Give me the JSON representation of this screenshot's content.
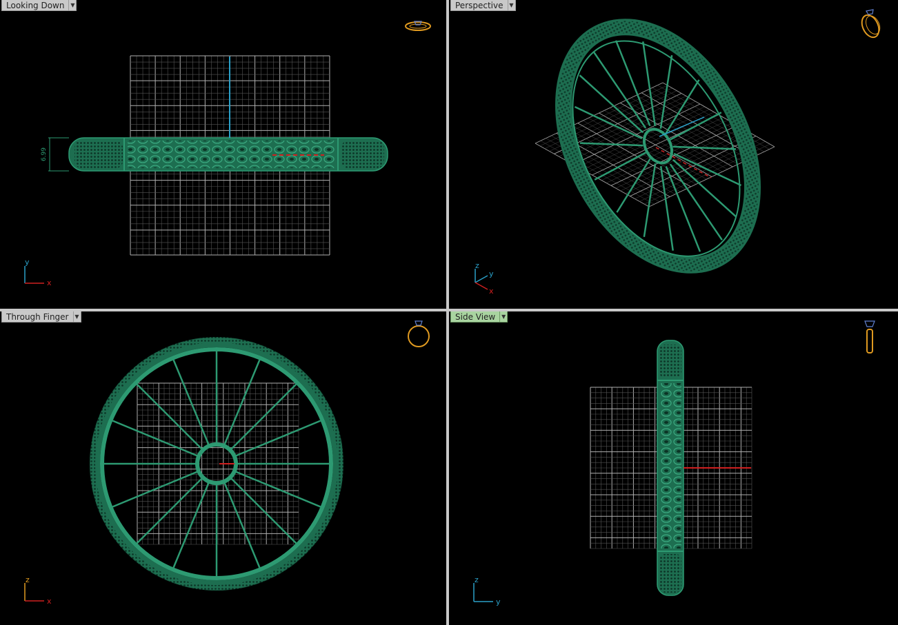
{
  "viewports": {
    "top_left": {
      "label": "Looking Down",
      "dimension": "6.99",
      "axes": [
        "y",
        "x"
      ]
    },
    "top_right": {
      "label": "Perspective",
      "axes": [
        "z",
        "y",
        "x"
      ]
    },
    "bottom_left": {
      "label": "Through Finger",
      "axes": [
        "z",
        "x"
      ]
    },
    "bottom_right": {
      "label": "Side View",
      "axes": [
        "z",
        "y"
      ]
    }
  },
  "colors": {
    "model": "#1f7a5a",
    "grid": "#9a9a9a",
    "axis_x": "#d02020",
    "axis_y": "#2aa0c8",
    "axis_z": "#2aa0c8",
    "active_label": "#a9d4a0"
  },
  "icons": [
    "ring-top-icon",
    "ring-perspective-icon",
    "ring-front-icon",
    "ring-side-icon"
  ]
}
